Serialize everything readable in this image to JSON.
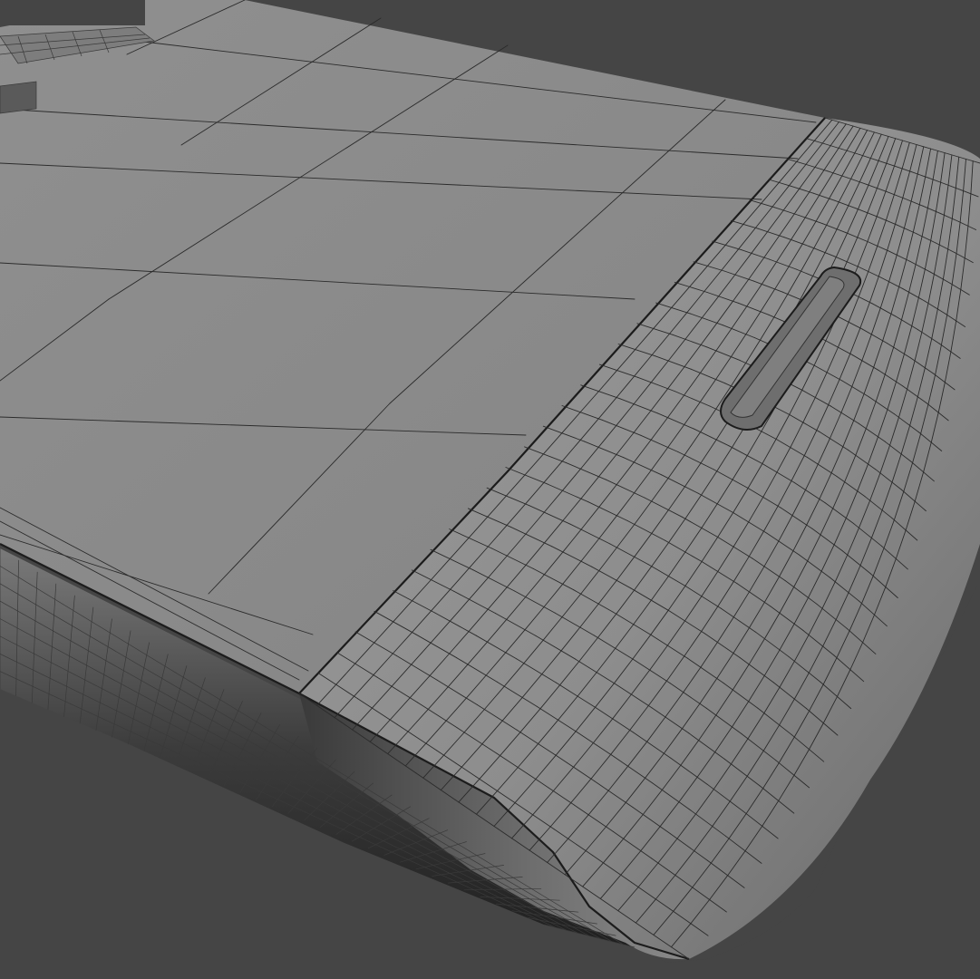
{
  "scene": {
    "subject": "",
    "colors": {
      "background": "#454545",
      "surface_flat": "#8c8c8c",
      "surface_light": "#a3a3a3",
      "surface_dark": "#2e2e2e",
      "wire": "#2b2b2b"
    }
  }
}
